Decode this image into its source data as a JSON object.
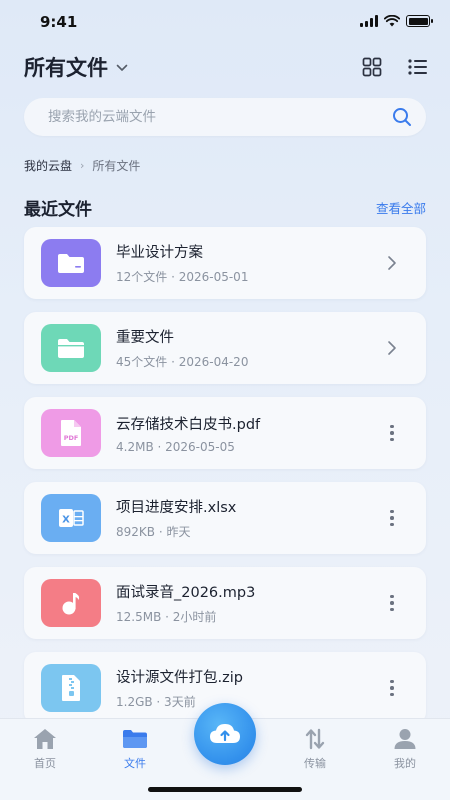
{
  "status_bar": {
    "time": "9:41"
  },
  "header": {
    "title": "所有文件"
  },
  "search": {
    "placeholder": "搜索我的云端文件"
  },
  "breadcrumb": {
    "root": "我的云盘",
    "current": "所有文件"
  },
  "section": {
    "title": "最近文件",
    "view_all": "查看全部"
  },
  "files": [
    {
      "name": "毕业设计方案",
      "meta": "12个文件 · 2026-05-01",
      "type": "folder",
      "icon": "folder-icon",
      "color": "#8c7cf0",
      "action": "chevron-right-icon"
    },
    {
      "name": "重要文件",
      "meta": "45个文件 · 2026-04-20",
      "type": "folder",
      "icon": "folder-icon",
      "color": "#6ed8b7",
      "action": "chevron-right-icon"
    },
    {
      "name": "云存储技术白皮书.pdf",
      "meta": "4.2MB · 2026-05-05",
      "type": "pdf",
      "icon": "pdf-icon",
      "color": "#ef9be6",
      "action": "more-icon"
    },
    {
      "name": "项目进度安排.xlsx",
      "meta": "892KB · 昨天",
      "type": "excel",
      "icon": "excel-icon",
      "color": "#6aaef2",
      "action": "more-icon"
    },
    {
      "name": "面试录音_2026.mp3",
      "meta": "12.5MB · 2小时前",
      "type": "audio",
      "icon": "audio-icon",
      "color": "#f47d86",
      "action": "more-icon"
    },
    {
      "name": "设计源文件打包.zip",
      "meta": "1.2GB · 3天前",
      "type": "zip",
      "icon": "zip-icon",
      "color": "#7cc6f0",
      "action": "more-icon"
    }
  ],
  "tabbar": {
    "home": "首页",
    "files": "文件",
    "transfer": "传输",
    "mine": "我的",
    "active": "files"
  },
  "colors": {
    "accent": "#3a7bec"
  }
}
